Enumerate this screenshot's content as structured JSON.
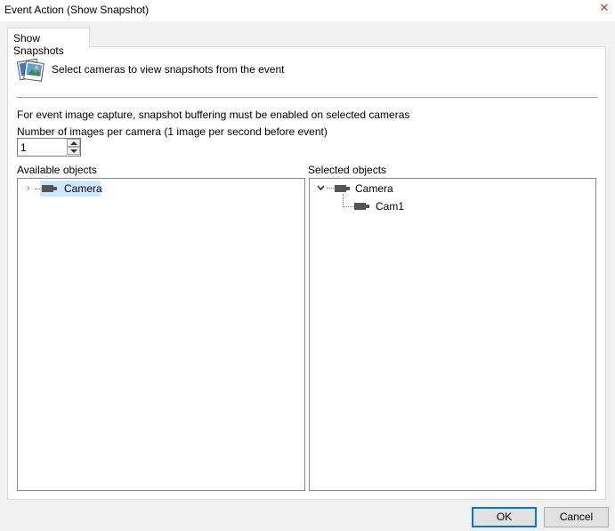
{
  "window": {
    "title": "Event Action (Show Snapshot)",
    "close_icon": "close-icon"
  },
  "tabs": [
    {
      "label": "Show Snapshots",
      "active": true
    }
  ],
  "header": {
    "icon": "snapshot-icon",
    "text": "Select cameras to view snapshots from the event"
  },
  "info": {
    "text": "For event image capture, snapshot buffering must be enabled on selected cameras",
    "images_label": "Number of images per camera (1 image per second before event)",
    "images_value": "1"
  },
  "available": {
    "label": "Available objects",
    "items": [
      {
        "label": "Camera",
        "expanded": false,
        "selected": true,
        "icon": "camera-icon"
      }
    ]
  },
  "selected": {
    "label": "Selected objects",
    "items": [
      {
        "label": "Camera",
        "expanded": true,
        "icon": "camera-icon",
        "children": [
          {
            "label": "Cam1",
            "icon": "camera-icon"
          }
        ]
      }
    ]
  },
  "buttons": {
    "ok": "OK",
    "cancel": "Cancel"
  },
  "colors": {
    "selection": "#cce8ff",
    "default_button_border": "#0078d7",
    "close": "#c0392b"
  }
}
